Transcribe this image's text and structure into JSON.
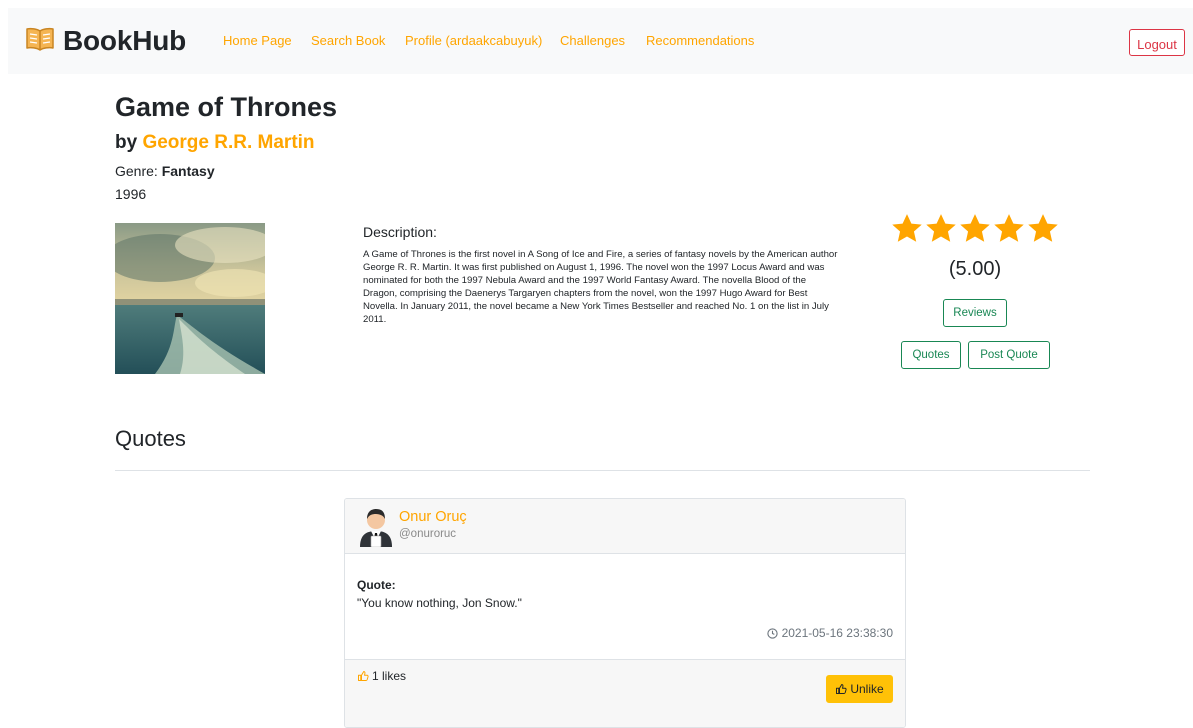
{
  "navbar": {
    "brand": "BookHub",
    "links": [
      "Home Page",
      "Search Book",
      "Profile (ardaakcabuyuk)",
      "Challenges",
      "Recommendations"
    ],
    "logout_label": "Logout",
    "brand_icon": "book-open-icon"
  },
  "book": {
    "title": "Game of Thrones",
    "by_prefix": "by ",
    "author": "George R.R. Martin",
    "genre_label": "Genre: ",
    "genre": "Fantasy",
    "year": "1996",
    "description_title": "Description:",
    "description": "A Game of Thrones is the first novel in A Song of Ice and Fire, a series of fantasy novels by the American author George R. R. Martin. It was first published on August 1, 1996. The novel won the 1997 Locus Award and was nominated for both the 1997 Nebula Award and the 1997 World Fantasy Award. The novella Blood of the Dragon, comprising the Daenerys Targaryen chapters from the novel, won the 1997 Hugo Award for Best Novella. In January 2011, the novel became a New York Times Bestseller and reached No. 1 on the list in July 2011.",
    "rating_stars": 5,
    "rating_text": "(5.00)"
  },
  "actions": {
    "reviews_label": "Reviews",
    "quotes_label": "Quotes",
    "post_quote_label": "Post Quote"
  },
  "quotes_section": {
    "title": "Quotes"
  },
  "quote_card": {
    "user_name": "Onur Oruç",
    "user_handle": "@onuroruc",
    "quote_label": "Quote:",
    "quote_text": "\"You know nothing, Jon Snow.\"",
    "timestamp": "2021-05-16 23:38:30",
    "likes_text": "1 likes",
    "unlike_label": "Unlike"
  },
  "colors": {
    "accent": "#ffa500",
    "success": "#198754",
    "danger": "#dc3545",
    "warning": "#ffc107"
  }
}
